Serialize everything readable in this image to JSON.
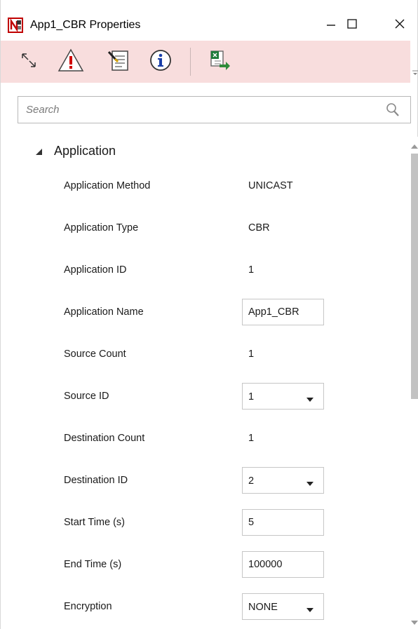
{
  "window": {
    "title": "App1_CBR Properties",
    "icons": {
      "app": "netsim-app-icon",
      "minimize": "minimize-icon",
      "maximize": "maximize-icon",
      "close": "close-icon"
    }
  },
  "toolbar": {
    "buttons": [
      {
        "icon": "expand-collapse-icon"
      },
      {
        "icon": "warning-icon"
      },
      {
        "icon": "notes-edit-icon"
      },
      {
        "icon": "info-icon"
      },
      {
        "icon": "excel-export-icon"
      }
    ],
    "accent": "#f8dddd"
  },
  "search": {
    "placeholder": "Search",
    "value": ""
  },
  "section": {
    "title": "Application",
    "expanded": true
  },
  "properties": [
    {
      "label": "Application Method",
      "kind": "text",
      "value": "UNICAST"
    },
    {
      "label": "Application Type",
      "kind": "text",
      "value": "CBR"
    },
    {
      "label": "Application ID",
      "kind": "text",
      "value": "1"
    },
    {
      "label": "Application Name",
      "kind": "input",
      "value": "App1_CBR"
    },
    {
      "label": "Source Count",
      "kind": "text",
      "value": "1"
    },
    {
      "label": "Source ID",
      "kind": "select",
      "value": "1"
    },
    {
      "label": "Destination Count",
      "kind": "text",
      "value": "1"
    },
    {
      "label": "Destination ID",
      "kind": "select",
      "value": "2"
    },
    {
      "label": "Start Time (s)",
      "kind": "input",
      "value": "5"
    },
    {
      "label": "End Time (s)",
      "kind": "input",
      "value": "100000"
    },
    {
      "label": "Encryption",
      "kind": "select",
      "value": "NONE"
    }
  ]
}
